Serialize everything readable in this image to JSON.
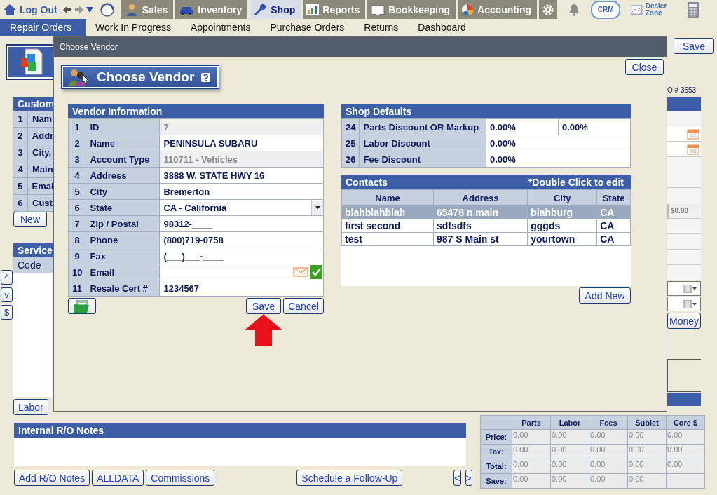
{
  "top_nav": {
    "log_out": "Log Out",
    "modules": [
      {
        "label": "Sales",
        "selected": false
      },
      {
        "label": "Inventory",
        "selected": false
      },
      {
        "label": "Shop",
        "selected": true
      },
      {
        "label": "Reports",
        "selected": false
      },
      {
        "label": "Bookkeeping",
        "selected": false
      },
      {
        "label": "Accounting",
        "selected": false
      }
    ],
    "crm": "CRM",
    "dealer_zone": "Dealer Zone"
  },
  "sub_nav": [
    {
      "label": "Repair Orders",
      "selected": true
    },
    {
      "label": "Work In Progress",
      "selected": false
    },
    {
      "label": "Appointments",
      "selected": false
    },
    {
      "label": "Purchase Orders",
      "selected": false
    },
    {
      "label": "Returns",
      "selected": false
    },
    {
      "label": "Dashboard",
      "selected": false
    }
  ],
  "background": {
    "customer_panel": {
      "title": "Custom",
      "rows": [
        {
          "num": "1",
          "label": "Nam"
        },
        {
          "num": "2",
          "label": "Addr"
        },
        {
          "num": "3",
          "label": "City,"
        },
        {
          "num": "4",
          "label": "Main"
        },
        {
          "num": "5",
          "label": "Emai"
        },
        {
          "num": "6",
          "label": "Cust"
        }
      ]
    },
    "new_button": "New",
    "service_panel": {
      "title": "Service",
      "column": "Code"
    },
    "side_buttons": [
      "^",
      "v",
      "$"
    ],
    "labor_button": "Labor",
    "save_button": "Save",
    "ro_number": "O # 3553",
    "amount": "$0.00",
    "money_button": "Money",
    "notes_title": "Internal R/O Notes",
    "bottom_buttons": [
      "Add R/O Notes",
      "ALLDATA",
      "Commissions"
    ],
    "follow_up_button": "Schedule a Follow-Up",
    "pager": [
      "<",
      ">"
    ],
    "totals": {
      "columns": [
        "Parts",
        "Labor",
        "Fees",
        "Sublet",
        "Core $"
      ],
      "rows": [
        {
          "label": "Price:",
          "values": [
            "0.00",
            "0.00",
            "0.00",
            "0.00",
            "0.00"
          ]
        },
        {
          "label": "Tax:",
          "values": [
            "0.00",
            "0.00",
            "0.00",
            "0.00",
            "0.00"
          ]
        },
        {
          "label": "Total:",
          "values": [
            "0.00",
            "0.00",
            "0.00",
            "0.00",
            "0.00"
          ]
        },
        {
          "label": "Save:",
          "values": [
            "0.00",
            "0.00",
            "0.00",
            "0.00",
            "--"
          ]
        }
      ]
    }
  },
  "modal": {
    "title": "Choose Vendor",
    "heading": "Choose Vendor",
    "close": "Close",
    "vendor_info": {
      "title": "Vendor Information",
      "rows": [
        {
          "num": "1",
          "label": "ID",
          "value": "7",
          "kind": "readonly"
        },
        {
          "num": "2",
          "label": "Name",
          "value": "PENINSULA SUBARU",
          "kind": "text"
        },
        {
          "num": "3",
          "label": "Account Type",
          "value": "110711 - Vehicles",
          "kind": "readonly"
        },
        {
          "num": "4",
          "label": "Address",
          "value": "3888 W. STATE HWY 16",
          "kind": "text"
        },
        {
          "num": "5",
          "label": "City",
          "value": "Bremerton",
          "kind": "text"
        },
        {
          "num": "6",
          "label": "State",
          "value": "CA - California",
          "kind": "select"
        },
        {
          "num": "7",
          "label": "Zip / Postal",
          "value": "98312-____",
          "kind": "text"
        },
        {
          "num": "8",
          "label": "Phone",
          "value": "(800)719-0758",
          "kind": "text"
        },
        {
          "num": "9",
          "label": "Fax",
          "value": "(___)___-____",
          "kind": "text"
        },
        {
          "num": "10",
          "label": "Email",
          "kind": "email"
        },
        {
          "num": "11",
          "label": "Resale Cert #",
          "value": "1234567",
          "kind": "text"
        }
      ]
    },
    "save": "Save",
    "cancel": "Cancel",
    "shop_defaults": {
      "title": "Shop Defaults",
      "rows": [
        {
          "num": "24",
          "label": "Parts Discount OR Markup",
          "values": [
            "0.00%",
            "0.00%"
          ]
        },
        {
          "num": "25",
          "label": "Labor Discount",
          "values": [
            "0.00%"
          ]
        },
        {
          "num": "26",
          "label": "Fee Discount",
          "values": [
            "0.00%"
          ]
        }
      ]
    },
    "contacts": {
      "title": "Contacts",
      "hint": "*Double Click to edit",
      "columns": [
        "Name",
        "Address",
        "City",
        "State"
      ],
      "rows": [
        {
          "cells": [
            "blahblahblah",
            "65478 n main",
            "blahburg",
            "CA"
          ],
          "selected": true
        },
        {
          "cells": [
            "first second",
            "sdfsdfs",
            "gggds",
            "CA"
          ],
          "selected": false
        },
        {
          "cells": [
            "test",
            "987 S Main st",
            "yourtown",
            "CA"
          ],
          "selected": false
        }
      ]
    },
    "add_new": "Add New"
  }
}
